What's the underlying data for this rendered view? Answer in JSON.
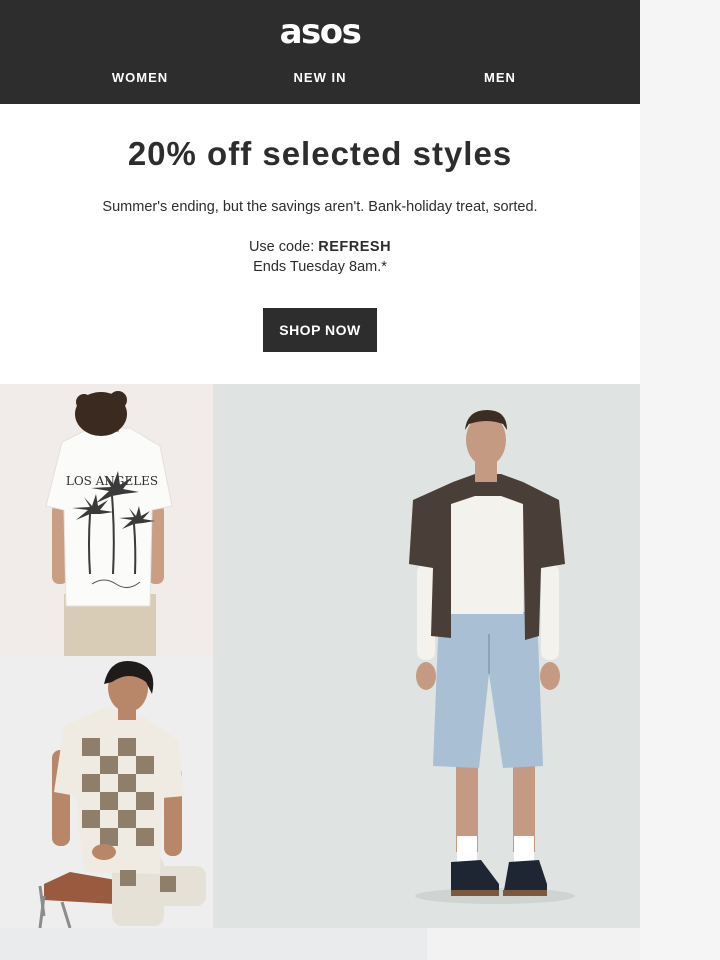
{
  "brand": {
    "logo_text": "asos"
  },
  "nav": {
    "items": [
      "WOMEN",
      "NEW IN",
      "MEN"
    ]
  },
  "promo": {
    "title": "20% off selected styles",
    "subtitle": "Summer's ending, but the savings aren't. Bank-holiday treat, sorted.",
    "code_prefix": "Use code: ",
    "code": "REFRESH",
    "ends": "Ends Tuesday 8am.*",
    "cta_label": "SHOP NOW"
  },
  "images": {
    "a_print_text": "LOS ANGELES"
  },
  "colors": {
    "header_bg": "#2d2d2d",
    "button_bg": "#2d2d2d",
    "text": "#2d2d2d",
    "page_bg": "#f5f5f5"
  }
}
